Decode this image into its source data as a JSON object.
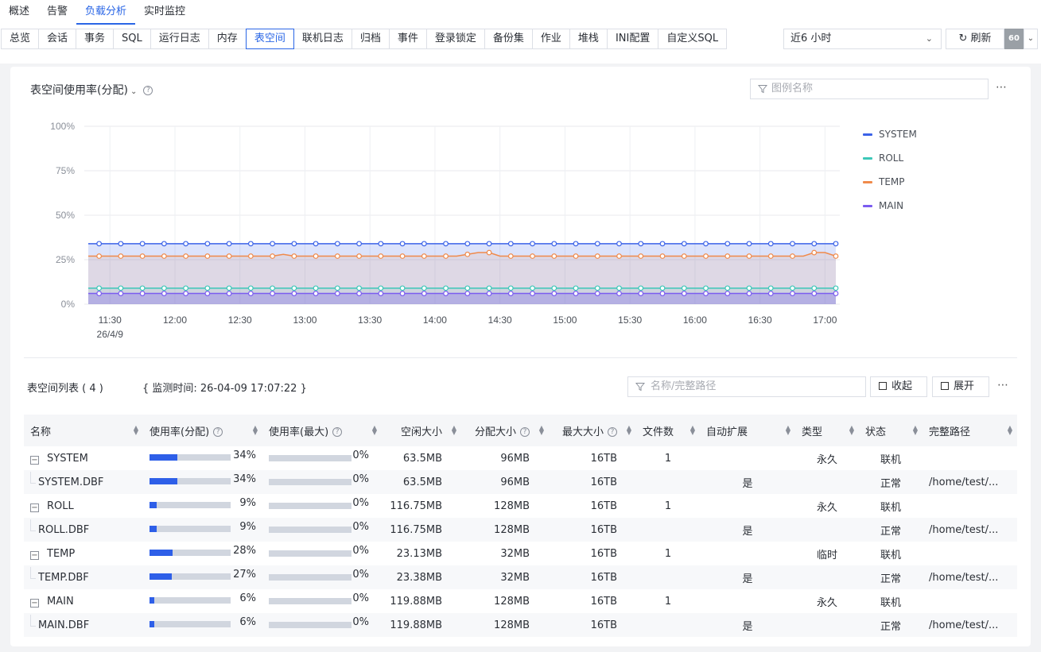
{
  "main_tabs": [
    {
      "label": "概述",
      "active": false
    },
    {
      "label": "告警",
      "active": false
    },
    {
      "label": "负载分析",
      "active": true
    },
    {
      "label": "实时监控",
      "active": false
    }
  ],
  "sub_tabs": [
    {
      "label": "总览"
    },
    {
      "label": "会话"
    },
    {
      "label": "事务"
    },
    {
      "label": "SQL"
    },
    {
      "label": "运行日志"
    },
    {
      "label": "内存"
    },
    {
      "label": "表空间",
      "active": true
    },
    {
      "label": "联机日志"
    },
    {
      "label": "归档"
    },
    {
      "label": "事件"
    },
    {
      "label": "登录锁定"
    },
    {
      "label": "备份集"
    },
    {
      "label": "作业"
    },
    {
      "label": "堆栈"
    },
    {
      "label": "INI配置"
    },
    {
      "label": "自定义SQL"
    }
  ],
  "toolbar": {
    "time_range": "近6 小时",
    "refresh_label": "刷新",
    "refresh_interval": "60"
  },
  "chart_panel": {
    "title": "表空间使用率(分配)",
    "legend_filter_placeholder": "图例名称"
  },
  "chart_data": {
    "type": "area",
    "title": "表空间使用率(分配)",
    "x": [
      "11:20",
      "11:25",
      "11:30",
      "11:35",
      "11:40",
      "11:45",
      "11:50",
      "11:55",
      "12:00",
      "12:05",
      "12:10",
      "12:15",
      "12:20",
      "12:25",
      "12:30",
      "12:35",
      "12:40",
      "12:45",
      "12:50",
      "12:55",
      "13:00",
      "13:05",
      "13:10",
      "13:15",
      "13:20",
      "13:25",
      "13:30",
      "13:35",
      "13:40",
      "13:45",
      "13:50",
      "13:55",
      "14:00",
      "14:05",
      "14:10",
      "14:15",
      "14:20",
      "14:25",
      "14:30",
      "14:35",
      "14:40",
      "14:45",
      "14:50",
      "14:55",
      "15:00",
      "15:05",
      "15:10",
      "15:15",
      "15:20",
      "15:25",
      "15:30",
      "15:35",
      "15:40",
      "15:45",
      "15:50",
      "15:55",
      "16:00",
      "16:05",
      "16:10",
      "16:15",
      "16:20",
      "16:25",
      "16:30",
      "16:35",
      "16:40",
      "16:45",
      "16:50",
      "16:55",
      "17:00",
      "17:05"
    ],
    "x_ticks": [
      "11:30",
      "12:00",
      "12:30",
      "13:00",
      "13:30",
      "14:00",
      "14:30",
      "15:00",
      "15:30",
      "16:00",
      "16:30",
      "17:00"
    ],
    "x_date_label": "26/4/9",
    "y_ticks": [
      "100%",
      "75%",
      "50%",
      "25%",
      "0%"
    ],
    "ylim": [
      0,
      100
    ],
    "series": [
      {
        "name": "SYSTEM",
        "color": "#3b62e8",
        "values": [
          34,
          34,
          34,
          34,
          34,
          34,
          34,
          34,
          34,
          34,
          34,
          34,
          34,
          34,
          34,
          34,
          34,
          34,
          34,
          34,
          34,
          34,
          34,
          34,
          34,
          34,
          34,
          34,
          34,
          34,
          34,
          34,
          34,
          34,
          34,
          34,
          34,
          34,
          34,
          34,
          34,
          34,
          34,
          34,
          34,
          34,
          34,
          34,
          34,
          34,
          34,
          34,
          34,
          34,
          34,
          34,
          34,
          34,
          34,
          34,
          34,
          34,
          34,
          34,
          34,
          34,
          34,
          34,
          34,
          34
        ]
      },
      {
        "name": "ROLL",
        "color": "#3cc7b8",
        "values": [
          9,
          9,
          9,
          9,
          9,
          9,
          9,
          9,
          9,
          9,
          9,
          9,
          9,
          9,
          9,
          9,
          9,
          9,
          9,
          9,
          9,
          9,
          9,
          9,
          9,
          9,
          9,
          9,
          9,
          9,
          9,
          9,
          9,
          9,
          9,
          9,
          9,
          9,
          9,
          9,
          9,
          9,
          9,
          9,
          9,
          9,
          9,
          9,
          9,
          9,
          9,
          9,
          9,
          9,
          9,
          9,
          9,
          9,
          9,
          9,
          9,
          9,
          9,
          9,
          9,
          9,
          9,
          9,
          9,
          9
        ]
      },
      {
        "name": "TEMP",
        "color": "#f08a4b",
        "values": [
          27,
          27,
          27,
          27,
          27,
          27,
          27,
          27,
          27,
          27,
          27,
          27,
          27,
          27,
          27,
          27,
          27,
          27,
          28,
          27,
          27,
          27,
          27,
          27,
          27,
          27,
          27,
          27,
          27,
          27,
          27,
          27,
          27,
          27,
          27,
          28,
          29,
          29,
          27,
          27,
          27,
          27,
          27,
          27,
          27,
          27,
          27,
          27,
          27,
          27,
          27,
          27,
          27,
          27,
          27,
          27,
          27,
          27,
          27,
          27,
          27,
          27,
          27,
          27,
          27,
          27,
          27,
          29,
          29,
          27
        ]
      },
      {
        "name": "MAIN",
        "color": "#7b5cf0",
        "values": [
          6,
          6,
          6,
          6,
          6,
          6,
          6,
          6,
          6,
          6,
          6,
          6,
          6,
          6,
          6,
          6,
          6,
          6,
          6,
          6,
          6,
          6,
          6,
          6,
          6,
          6,
          6,
          6,
          6,
          6,
          6,
          6,
          6,
          6,
          6,
          6,
          6,
          6,
          6,
          6,
          6,
          6,
          6,
          6,
          6,
          6,
          6,
          6,
          6,
          6,
          6,
          6,
          6,
          6,
          6,
          6,
          6,
          6,
          6,
          6,
          6,
          6,
          6,
          6,
          6,
          6,
          6,
          6,
          6,
          6
        ]
      }
    ],
    "legend_position": "right",
    "grid": true
  },
  "list": {
    "title": "表空间列表 ( 4 )",
    "monitor_time": "{ 监测时间: 26-04-09 17:07:22 }",
    "filter_placeholder": "名称/完整路径",
    "collapse_label": "收起",
    "expand_label": "展开",
    "columns": [
      "名称",
      "使用率(分配)",
      "使用率(最大)",
      "空闲大小",
      "分配大小",
      "最大大小",
      "文件数",
      "自动扩展",
      "类型",
      "状态",
      "完整路径"
    ],
    "rows": [
      {
        "name": "SYSTEM",
        "usage_alloc": 34,
        "usage_alloc_text": "34%",
        "usage_max": 0,
        "usage_max_text": "0%",
        "free": "63.5MB",
        "alloc": "96MB",
        "max": "16TB",
        "files": "1",
        "autoext": "",
        "type": "永久",
        "status": "联机",
        "path": ""
      },
      {
        "name": "SYSTEM.DBF",
        "child": true,
        "usage_alloc": 34,
        "usage_alloc_text": "34%",
        "usage_max": 0,
        "usage_max_text": "0%",
        "free": "63.5MB",
        "alloc": "96MB",
        "max": "16TB",
        "files": "",
        "autoext": "是",
        "type": "",
        "status": "正常",
        "path": "/home/test/..."
      },
      {
        "name": "ROLL",
        "usage_alloc": 9,
        "usage_alloc_text": "9%",
        "usage_max": 0,
        "usage_max_text": "0%",
        "free": "116.75MB",
        "alloc": "128MB",
        "max": "16TB",
        "files": "1",
        "autoext": "",
        "type": "永久",
        "status": "联机",
        "path": ""
      },
      {
        "name": "ROLL.DBF",
        "child": true,
        "usage_alloc": 9,
        "usage_alloc_text": "9%",
        "usage_max": 0,
        "usage_max_text": "0%",
        "free": "116.75MB",
        "alloc": "128MB",
        "max": "16TB",
        "files": "",
        "autoext": "是",
        "type": "",
        "status": "正常",
        "path": "/home/test/..."
      },
      {
        "name": "TEMP",
        "usage_alloc": 28,
        "usage_alloc_text": "28%",
        "usage_max": 0,
        "usage_max_text": "0%",
        "free": "23.13MB",
        "alloc": "32MB",
        "max": "16TB",
        "files": "1",
        "autoext": "",
        "type": "临时",
        "status": "联机",
        "path": ""
      },
      {
        "name": "TEMP.DBF",
        "child": true,
        "usage_alloc": 27,
        "usage_alloc_text": "27%",
        "usage_max": 0,
        "usage_max_text": "0%",
        "free": "23.38MB",
        "alloc": "32MB",
        "max": "16TB",
        "files": "",
        "autoext": "是",
        "type": "",
        "status": "正常",
        "path": "/home/test/..."
      },
      {
        "name": "MAIN",
        "usage_alloc": 6,
        "usage_alloc_text": "6%",
        "usage_max": 0,
        "usage_max_text": "0%",
        "free": "119.88MB",
        "alloc": "128MB",
        "max": "16TB",
        "files": "1",
        "autoext": "",
        "type": "永久",
        "status": "联机",
        "path": ""
      },
      {
        "name": "MAIN.DBF",
        "child": true,
        "usage_alloc": 6,
        "usage_alloc_text": "6%",
        "usage_max": 0,
        "usage_max_text": "0%",
        "free": "119.88MB",
        "alloc": "128MB",
        "max": "16TB",
        "files": "",
        "autoext": "是",
        "type": "",
        "status": "正常",
        "path": "/home/test/..."
      }
    ]
  }
}
